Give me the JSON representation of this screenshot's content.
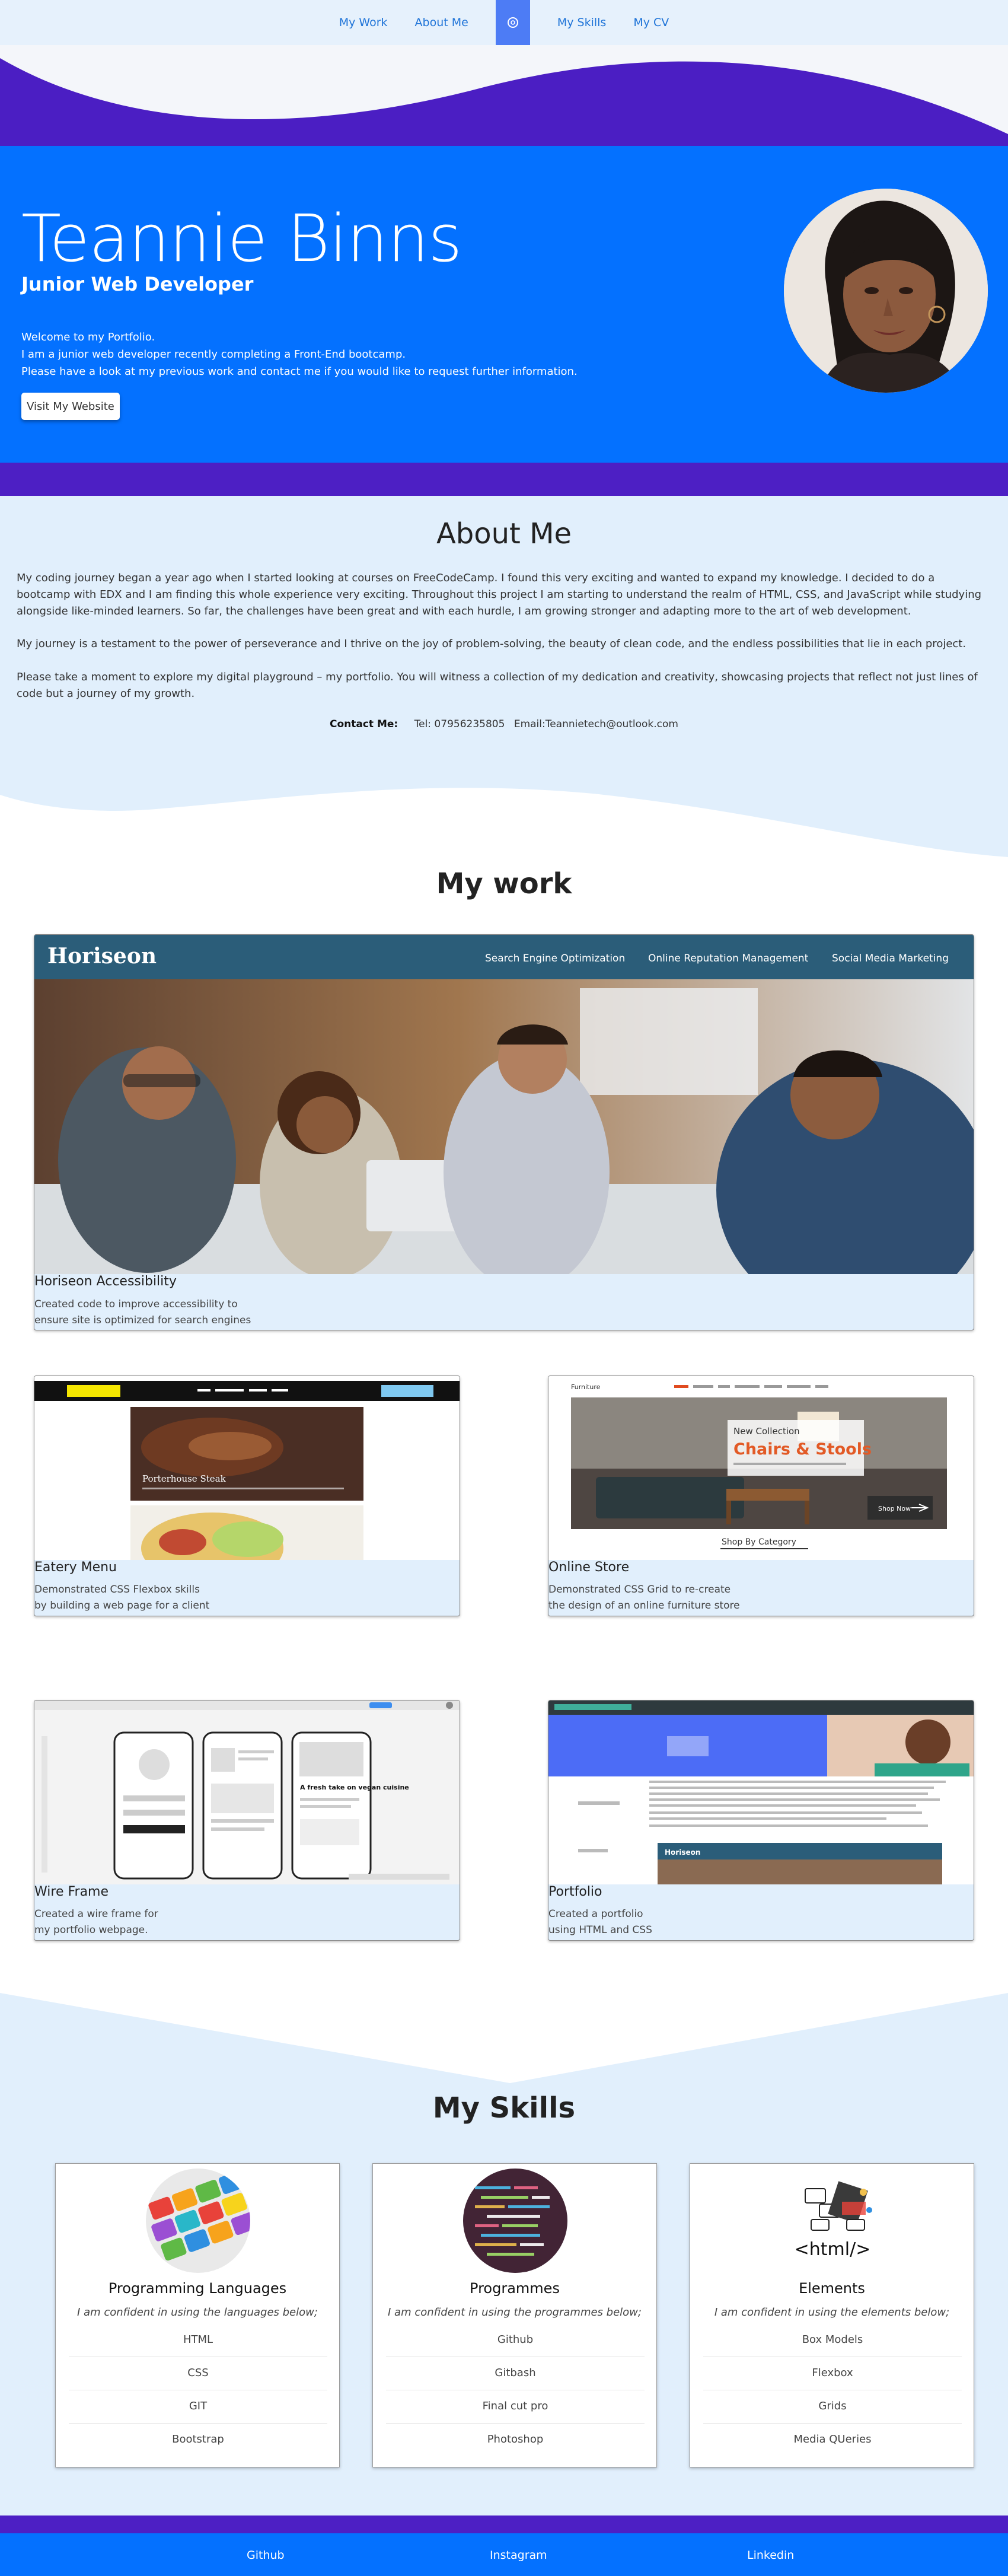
{
  "nav": {
    "items": [
      {
        "label": "My Work"
      },
      {
        "label": "About Me"
      },
      {
        "label": "My Skills"
      },
      {
        "label": "My CV"
      }
    ],
    "home_icon": "home-icon"
  },
  "hero": {
    "name": "Teannie Binns",
    "role": "Junior Web Developer",
    "intro": [
      "Welcome to my Portfolio.",
      "I am a junior web developer recently completing a Front-End bootcamp.",
      "Please have a look at my previous work and contact me if you would like to request further information."
    ],
    "button": "Visit My Website"
  },
  "about": {
    "title": "About Me",
    "paragraphs": [
      "My coding journey began a year ago when I started looking at courses on FreeCodeCamp. I found this very exciting and wanted to expand my knowledge. I decided to do a bootcamp with EDX and I am finding this whole experience very exciting. Throughout this project I am starting to understand the realm of HTML, CSS, and JavaScript while studying alongside like-minded learners. So far, the challenges have been great and with each hurdle, I am growing stronger and adapting more to the art of web development.",
      "My journey is a testament to the power of perseverance and I thrive on the joy of problem-solving, the beauty of clean code, and the endless possibilities that lie in each project.",
      "Please take a moment to explore my digital playground – my portfolio. You will witness a collection of my dedication and creativity, showcasing projects that reflect not just lines of code but a journey of my growth."
    ],
    "contact_label": "Contact Me:",
    "tel": "Tel: 07956235805",
    "email": "Email:Teannietech@outlook.com"
  },
  "work": {
    "title": "My work",
    "projects": [
      {
        "title": "Horiseon Accessibility",
        "desc": [
          "Created code to improve accessibility to",
          "ensure site is optimized for search engines"
        ]
      },
      {
        "title": "Eatery Menu",
        "desc": [
          "Demonstrated CSS Flexbox skills",
          "by building a web page for a client"
        ]
      },
      {
        "title": "Online Store",
        "desc": [
          "Demonstrated CSS Grid to re-create",
          "the design of an online furniture store"
        ]
      },
      {
        "title": "Wire Frame",
        "desc": [
          "Created a wire frame for",
          "my portfolio webpage."
        ]
      },
      {
        "title": "Portfolio",
        "desc": [
          "Created a portfolio",
          "using HTML and CSS"
        ]
      }
    ],
    "shots": {
      "horiseon": {
        "brand": "Horiseon",
        "links": [
          "Search Engine Optimization",
          "Online Reputation Management",
          "Social Media Marketing"
        ]
      },
      "eatery": {
        "dish": "Porterhouse Steak"
      },
      "store": {
        "brand": "Furniture",
        "kicker": "New Collection",
        "headline": "Chairs & Stools",
        "shop": "Shop Now",
        "category": "Shop By Category"
      },
      "wireframe": {
        "heading": "A fresh take on vegan cuisine"
      },
      "portfolio": {
        "brand": "Horiseon"
      }
    }
  },
  "skills": {
    "title": "My Skills",
    "cards": [
      {
        "title": "Programming Languages",
        "lead": "I am confident in using the languages below;",
        "items": [
          "HTML",
          "CSS",
          "GIT",
          "Bootstrap"
        ]
      },
      {
        "title": "Programmes",
        "lead": "I am confident in using the programmes below;",
        "items": [
          "Github",
          "Gitbash",
          "Final cut pro",
          "Photoshop"
        ]
      },
      {
        "title": "Elements",
        "lead": "I am confident in using the elements below;",
        "items": [
          "Box Models",
          "Flexbox",
          "Grids",
          "Media QUeries"
        ]
      }
    ],
    "elements_tag": "<html/>"
  },
  "footer": {
    "links": [
      "Github",
      "Instagram",
      "Linkedin"
    ]
  },
  "colors": {
    "hero_blue": "#0471ff",
    "purple": "#4d1fc4",
    "light_blue": "#e1effc",
    "nav_highlight": "#4d7cf5"
  }
}
